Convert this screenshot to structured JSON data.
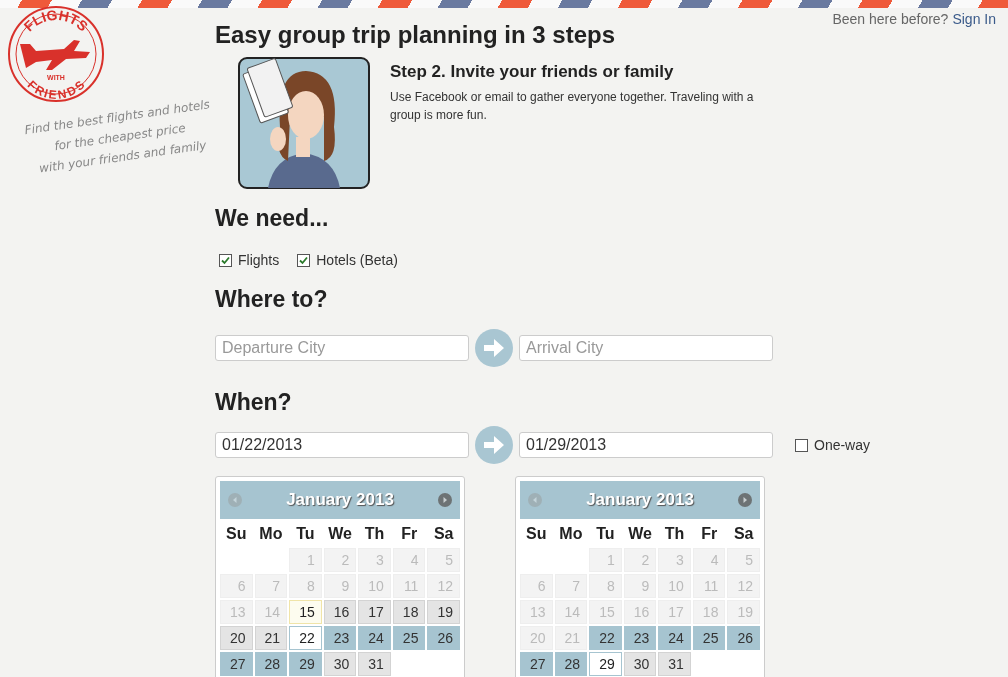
{
  "header": {
    "prompt": "Been here before?",
    "link": "Sign In"
  },
  "logo": {
    "top": "FLIGHTS",
    "middle": "WITH",
    "bottom": "FRIENDS"
  },
  "tagline": [
    "Find the best flights and hotels",
    "for the cheapest price",
    "with your friends and family"
  ],
  "title": "Easy group trip planning in 3 steps",
  "step": {
    "heading": "Step 2. Invite your friends or family",
    "text": "Use Facebook or email to gather everyone together. Traveling with a group is more fun."
  },
  "needs": {
    "heading": "We need...",
    "options": [
      {
        "label": "Flights",
        "checked": true
      },
      {
        "label": "Hotels (Beta)",
        "checked": true
      }
    ]
  },
  "where": {
    "heading": "Where to?",
    "from": {
      "placeholder": "Departure City"
    },
    "to": {
      "placeholder": "Arrival City"
    }
  },
  "when": {
    "heading": "When?",
    "from": {
      "value": "01/22/2013"
    },
    "to": {
      "value": "01/29/2013"
    },
    "one_way": {
      "label": "One-way",
      "checked": false
    }
  },
  "calendars": [
    {
      "title": "January 2013",
      "weekdays": [
        "Su",
        "Mo",
        "Tu",
        "We",
        "Th",
        "Fr",
        "Sa"
      ],
      "weeks": [
        [
          {
            "day": "1",
            "kind": "past"
          },
          {
            "day": "2",
            "kind": "past"
          },
          {
            "day": "3",
            "kind": "past"
          },
          {
            "day": "4",
            "kind": "past"
          },
          {
            "day": "5",
            "kind": "past"
          }
        ],
        [
          {
            "day": "6",
            "kind": "past"
          },
          {
            "day": "7",
            "kind": "past"
          },
          {
            "day": "8",
            "kind": "past"
          },
          {
            "day": "9",
            "kind": "past"
          },
          {
            "day": "10",
            "kind": "past"
          },
          {
            "day": "11",
            "kind": "past"
          },
          {
            "day": "12",
            "kind": "past"
          }
        ],
        [
          {
            "day": "13",
            "kind": "past"
          },
          {
            "day": "14",
            "kind": "past"
          },
          {
            "day": "15",
            "kind": "today"
          },
          {
            "day": "16",
            "kind": "open"
          },
          {
            "day": "17",
            "kind": "open"
          },
          {
            "day": "18",
            "kind": "open"
          },
          {
            "day": "19",
            "kind": "open"
          }
        ],
        [
          {
            "day": "20",
            "kind": "open"
          },
          {
            "day": "21",
            "kind": "open"
          },
          {
            "day": "22",
            "kind": "picked"
          },
          {
            "day": "23",
            "kind": "range"
          },
          {
            "day": "24",
            "kind": "range"
          },
          {
            "day": "25",
            "kind": "range"
          },
          {
            "day": "26",
            "kind": "range"
          }
        ],
        [
          {
            "day": "27",
            "kind": "range"
          },
          {
            "day": "28",
            "kind": "range"
          },
          {
            "day": "29",
            "kind": "range"
          },
          {
            "day": "30",
            "kind": "open"
          },
          {
            "day": "31",
            "kind": "open"
          }
        ]
      ]
    },
    {
      "title": "January 2013",
      "weekdays": [
        "Su",
        "Mo",
        "Tu",
        "We",
        "Th",
        "Fr",
        "Sa"
      ],
      "weeks": [
        [
          {
            "day": "1",
            "kind": "past"
          },
          {
            "day": "2",
            "kind": "past"
          },
          {
            "day": "3",
            "kind": "past"
          },
          {
            "day": "4",
            "kind": "past"
          },
          {
            "day": "5",
            "kind": "past"
          }
        ],
        [
          {
            "day": "6",
            "kind": "past"
          },
          {
            "day": "7",
            "kind": "past"
          },
          {
            "day": "8",
            "kind": "past"
          },
          {
            "day": "9",
            "kind": "past"
          },
          {
            "day": "10",
            "kind": "past"
          },
          {
            "day": "11",
            "kind": "past"
          },
          {
            "day": "12",
            "kind": "past"
          }
        ],
        [
          {
            "day": "13",
            "kind": "past"
          },
          {
            "day": "14",
            "kind": "past"
          },
          {
            "day": "15",
            "kind": "past"
          },
          {
            "day": "16",
            "kind": "past"
          },
          {
            "day": "17",
            "kind": "past"
          },
          {
            "day": "18",
            "kind": "past"
          },
          {
            "day": "19",
            "kind": "past"
          }
        ],
        [
          {
            "day": "20",
            "kind": "past"
          },
          {
            "day": "21",
            "kind": "past"
          },
          {
            "day": "22",
            "kind": "range"
          },
          {
            "day": "23",
            "kind": "range"
          },
          {
            "day": "24",
            "kind": "range"
          },
          {
            "day": "25",
            "kind": "range"
          },
          {
            "day": "26",
            "kind": "range"
          }
        ],
        [
          {
            "day": "27",
            "kind": "range"
          },
          {
            "day": "28",
            "kind": "range"
          },
          {
            "day": "29",
            "kind": "picked"
          },
          {
            "day": "30",
            "kind": "open"
          },
          {
            "day": "31",
            "kind": "open"
          }
        ]
      ]
    }
  ]
}
